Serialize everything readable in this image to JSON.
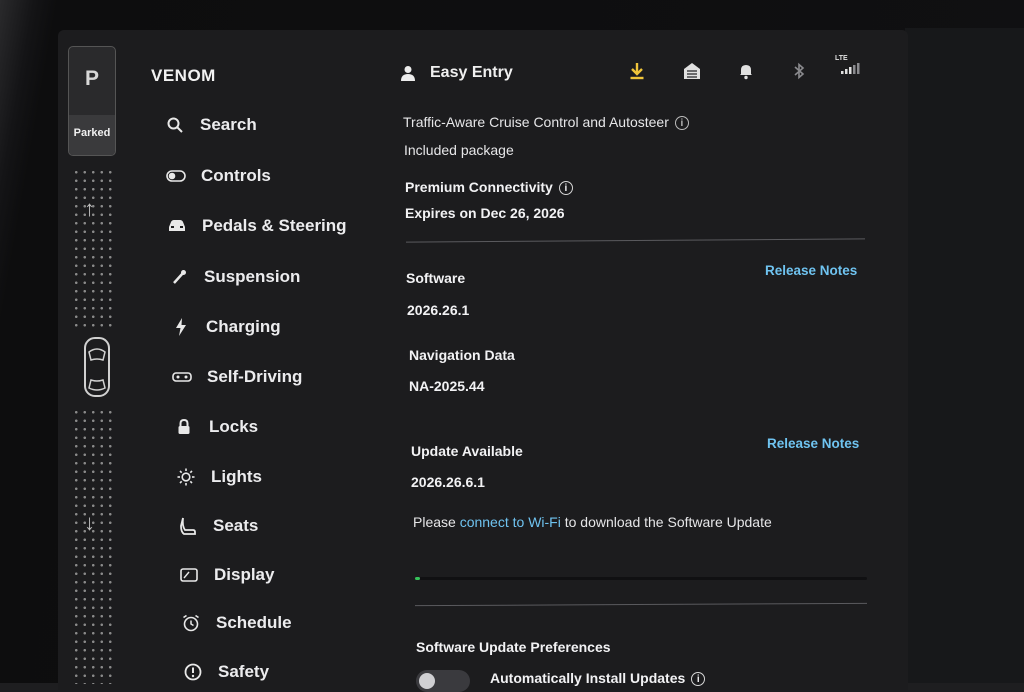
{
  "gear": {
    "letter": "P",
    "state": "Parked"
  },
  "brand": "VENOM",
  "sidebar": {
    "items": [
      {
        "label": "Search",
        "icon": "search-icon"
      },
      {
        "label": "Controls",
        "icon": "toggle-icon"
      },
      {
        "label": "Pedals & Steering",
        "icon": "car-icon"
      },
      {
        "label": "Suspension",
        "icon": "wrench-icon"
      },
      {
        "label": "Charging",
        "icon": "bolt-icon"
      },
      {
        "label": "Self-Driving",
        "icon": "steering-wheel-icon"
      },
      {
        "label": "Locks",
        "icon": "lock-icon"
      },
      {
        "label": "Lights",
        "icon": "sun-icon"
      },
      {
        "label": "Seats",
        "icon": "seat-icon"
      },
      {
        "label": "Display",
        "icon": "display-icon"
      },
      {
        "label": "Schedule",
        "icon": "alarm-clock-icon"
      },
      {
        "label": "Safety",
        "icon": "safety-icon"
      }
    ]
  },
  "topbar": {
    "profile_label": "Easy Entry",
    "lte_label": "LTE",
    "icons": [
      "download-icon",
      "garage-icon",
      "bell-icon",
      "bluetooth-icon",
      "lte-signal-icon"
    ]
  },
  "main": {
    "package_title": "Traffic-Aware Cruise Control and Autosteer",
    "package_status": "Included package",
    "connectivity_title": "Premium Connectivity",
    "connectivity_expiry": "Expires on Dec 26, 2026",
    "software_label": "Software",
    "software_version": "2026.26.1",
    "release_notes_1": "Release Notes",
    "nav_data_label": "Navigation Data",
    "nav_data_version": "NA-2025.44",
    "update_label": "Update Available",
    "update_version": "2026.26.6.1",
    "release_notes_2": "Release Notes",
    "wifi_prefix": "Please ",
    "wifi_link": "connect to Wi-Fi",
    "wifi_suffix": " to download the Software Update",
    "download_progress": 0.01,
    "prefs_title": "Software Update Preferences",
    "auto_install_label": "Automatically Install Updates",
    "auto_install_on": false
  },
  "colors": {
    "accent_link": "#6fc3f0",
    "download_icon": "#f0c53a",
    "progress": "#36c25a"
  }
}
